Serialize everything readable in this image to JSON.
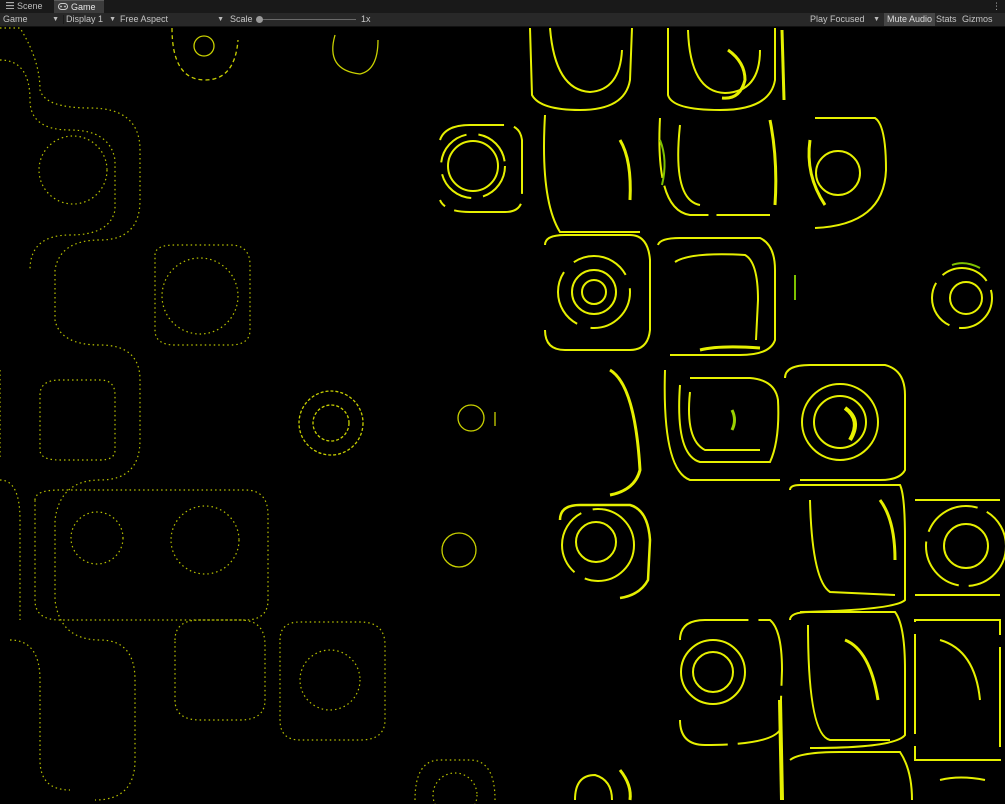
{
  "tabs": [
    {
      "label": "Scene",
      "icon": "menu-lines-icon"
    },
    {
      "label": "Game",
      "icon": "gamepad-icon"
    }
  ],
  "toolbar": {
    "view_select": "Game",
    "display_select": "Display 1",
    "aspect_select": "Free Aspect",
    "scale_label": "Scale",
    "scale_value": "1x",
    "play_mode_select": "Play Focused",
    "mute_label": "Mute Audio",
    "stats_label": "Stats",
    "gizmos_label": "Gizmos"
  },
  "colors": {
    "accent_yellow": "#e6f000",
    "dim_yellow": "#9aa200",
    "green_tint": "#7ec200",
    "background": "#000000",
    "toolbar": "#282828"
  }
}
